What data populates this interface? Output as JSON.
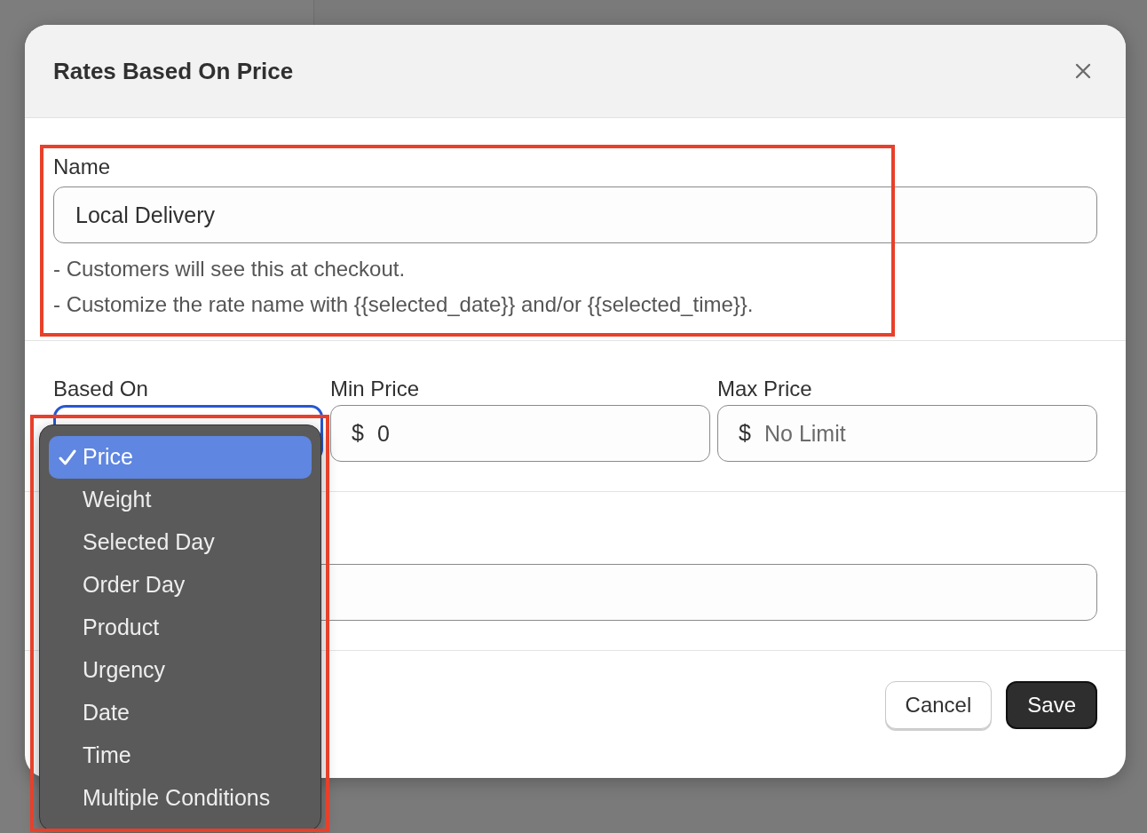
{
  "dialog": {
    "title": "Rates Based On Price",
    "name_field": {
      "label": "Name",
      "value": "Local Delivery",
      "hints": [
        "- Customers will see this at checkout.",
        "- Customize the rate name with {{selected_date}} and/or {{selected_time}}."
      ]
    },
    "based_on": {
      "label": "Based On",
      "expanded": true,
      "options": [
        {
          "label": "Price",
          "selected": true
        },
        {
          "label": "Weight",
          "selected": false
        },
        {
          "label": "Selected Day",
          "selected": false
        },
        {
          "label": "Order Day",
          "selected": false
        },
        {
          "label": "Product",
          "selected": false
        },
        {
          "label": "Urgency",
          "selected": false
        },
        {
          "label": "Date",
          "selected": false
        },
        {
          "label": "Time",
          "selected": false
        },
        {
          "label": "Multiple Conditions",
          "selected": false
        }
      ]
    },
    "min_price": {
      "label": "Min Price",
      "prefix": "$",
      "value": "0"
    },
    "max_price": {
      "label": "Max Price",
      "prefix": "$",
      "placeholder": "No Limit"
    },
    "buttons": [
      {
        "label": "Cancel",
        "kind": "secondary"
      },
      {
        "label": "Save",
        "kind": "primary"
      }
    ]
  }
}
